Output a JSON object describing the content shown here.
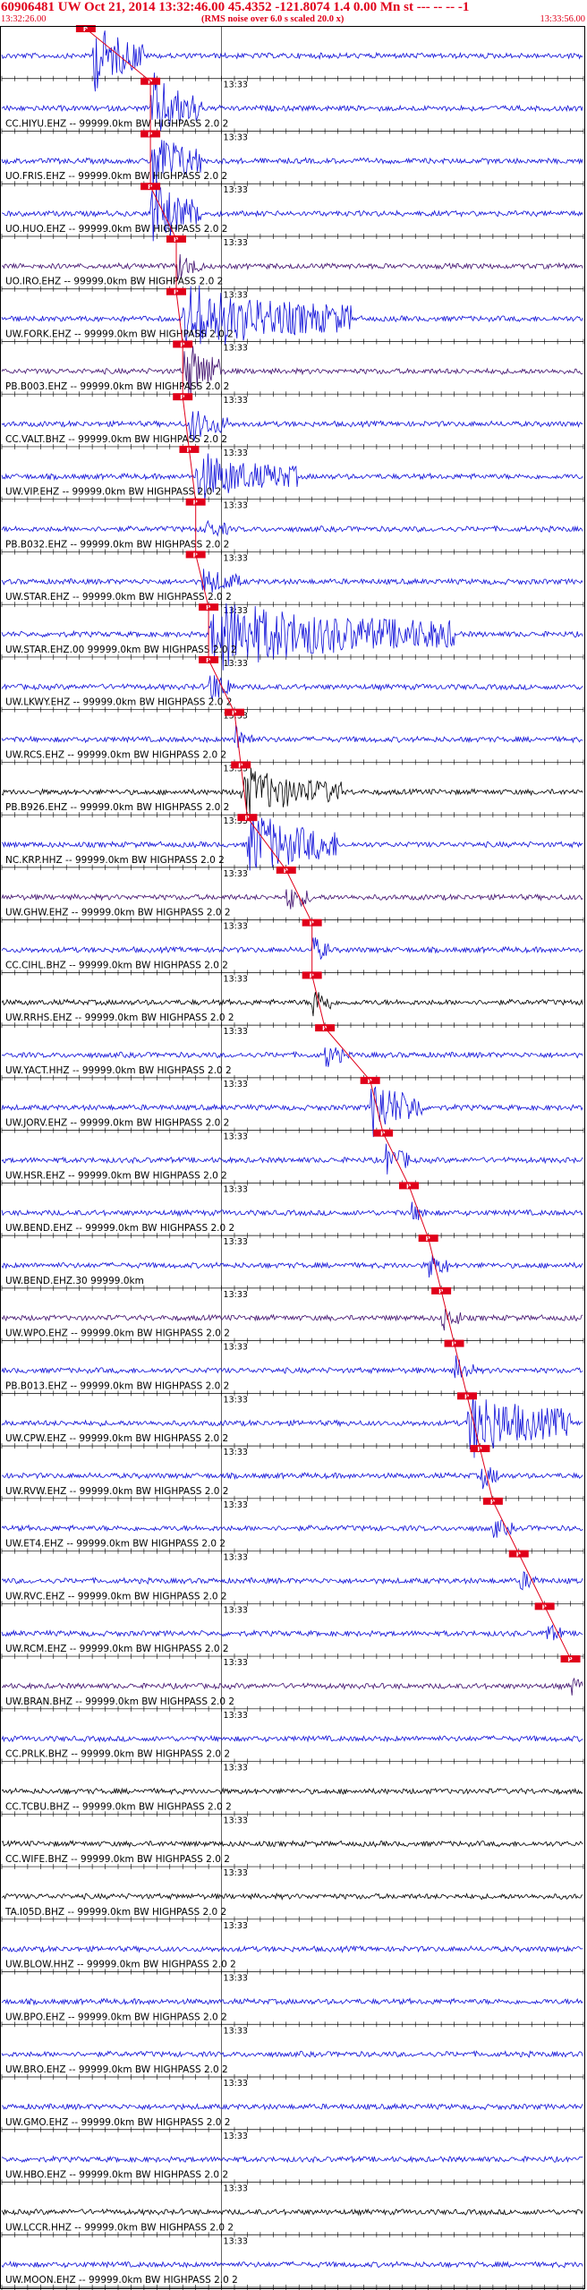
{
  "header": {
    "title": "60906481 UW Oct 21, 2014 13:32:46.00   45.4352 -121.8074  1.4 0.00 Mn st --- -- --  -1",
    "start_time": "13:32:26.00",
    "scale_note": "(RMS noise over 6.0 s scaled 20.0 x)",
    "end_time": "13:33:56.00"
  },
  "colors": {
    "trace_blue": "#1010d8",
    "trace_purple": "#40106e",
    "trace_black": "#000000",
    "pick_red": "#e0001a",
    "label_text": "#000000",
    "header_red": "#e0001a"
  },
  "chart_data": {
    "type": "seismogram-record-section",
    "time_window": {
      "start": "13:32:26.00",
      "end": "13:33:56.00",
      "minute_mark": "13:33"
    },
    "traces": [
      {
        "label": "",
        "color": "blue",
        "event_onset_s": 14,
        "duration_s": 8,
        "amplitude": 1.0,
        "pick_s": 13,
        "pick_label": "P"
      },
      {
        "label": "CC.HIYU.EHZ -- 99999.0km BW  HIGHPASS  2.0  2",
        "color": "blue",
        "event_onset_s": 23,
        "duration_s": 8,
        "amplitude": 1.0,
        "pick_s": 23,
        "pick_label": "P"
      },
      {
        "label": "UO.FRIS.EHZ -- 99999.0km BW  HIGHPASS  2.0  2",
        "color": "blue",
        "event_onset_s": 23,
        "duration_s": 8,
        "amplitude": 1.0,
        "pick_s": 23,
        "pick_label": "P"
      },
      {
        "label": "UO.HUO.EHZ -- 99999.0km BW  HIGHPASS  2.0  2",
        "color": "blue",
        "event_onset_s": 23,
        "duration_s": 8,
        "amplitude": 1.0,
        "pick_s": 23,
        "pick_label": "P"
      },
      {
        "label": "UO.IRO.EHZ -- 99999.0km BW  HIGHPASS  2.0  2",
        "color": "purple",
        "event_onset_s": 27,
        "duration_s": 4,
        "amplitude": 0.4,
        "pick_s": 27,
        "pick_label": "P"
      },
      {
        "label": "UW.FORK.EHZ -- 99999.0km BW  HIGHPASS  2.0  2",
        "color": "blue",
        "event_onset_s": 28,
        "duration_s": 26,
        "amplitude": 1.0,
        "pick_s": 27,
        "pick_label": "P"
      },
      {
        "label": "PB.B003.EHZ -- 99999.0km BW  HIGHPASS  2.0  2",
        "color": "purple",
        "event_onset_s": 28,
        "duration_s": 6,
        "amplitude": 1.0,
        "pick_s": 28,
        "pick_label": "P"
      },
      {
        "label": "CC.VALT.BHZ -- 99999.0km BW  HIGHPASS  2.0  2",
        "color": "blue",
        "event_onset_s": 29,
        "duration_s": 6,
        "amplitude": 0.5,
        "pick_s": 28,
        "pick_label": "P"
      },
      {
        "label": "UW.VIP.EHZ -- 99999.0km BW  HIGHPASS  2.0  2",
        "color": "blue",
        "event_onset_s": 30,
        "duration_s": 16,
        "amplitude": 0.7,
        "pick_s": 29,
        "pick_label": "P"
      },
      {
        "label": "PB.B032.EHZ -- 99999.0km BW  HIGHPASS  2.0  2",
        "color": "blue",
        "event_onset_s": 31,
        "duration_s": 4,
        "amplitude": 0.3,
        "pick_s": 30,
        "pick_label": "P"
      },
      {
        "label": "UW.STAR.EHZ -- 99999.0km BW  HIGHPASS  2.0  2",
        "color": "blue",
        "event_onset_s": 31,
        "duration_s": 6,
        "amplitude": 0.4,
        "pick_s": 30,
        "pick_label": "P"
      },
      {
        "label": "UW.STAR.EHZ.00 99999.0km BW  HIGHPASS  2.0  2",
        "color": "blue",
        "event_onset_s": 32,
        "duration_s": 38,
        "amplitude": 1.0,
        "pick_s": 32,
        "pick_label": "P"
      },
      {
        "label": "UW.LKWY.EHZ -- 99999.0km BW  HIGHPASS  2.0  2",
        "color": "blue",
        "event_onset_s": 32,
        "duration_s": 4,
        "amplitude": 0.5,
        "pick_s": 32,
        "pick_label": "P"
      },
      {
        "label": "UW.RCS.EHZ -- 99999.0km BW  HIGHPASS  2.0  2",
        "color": "blue",
        "event_onset_s": 36,
        "duration_s": 3,
        "amplitude": 0.4,
        "pick_s": 36,
        "pick_label": "P"
      },
      {
        "label": "PB.B926.EHZ -- 99999.0km BW  HIGHPASS  2.0  2",
        "color": "black",
        "event_onset_s": 37,
        "duration_s": 16,
        "amplitude": 0.7,
        "pick_s": 37,
        "pick_label": "P"
      },
      {
        "label": "NC.KRP.HHZ -- 99999.0km BW  HIGHPASS  2.0  2",
        "color": "blue",
        "event_onset_s": 38,
        "duration_s": 14,
        "amplitude": 1.0,
        "pick_s": 38,
        "pick_label": "P"
      },
      {
        "label": "UW.GHW.EHZ -- 99999.0km BW  HIGHPASS  2.0  2",
        "color": "purple",
        "event_onset_s": 44,
        "duration_s": 4,
        "amplitude": 0.4,
        "pick_s": 44,
        "pick_label": "P"
      },
      {
        "label": "CC.CIHL.BHZ -- 99999.0km BW  HIGHPASS  2.0  2",
        "color": "blue",
        "event_onset_s": 48,
        "duration_s": 3,
        "amplitude": 0.4,
        "pick_s": 48,
        "pick_label": "P"
      },
      {
        "label": "UW.RRHS.EHZ -- 99999.0km BW  HIGHPASS  2.0  2",
        "color": "black",
        "event_onset_s": 48,
        "duration_s": 3,
        "amplitude": 0.5,
        "pick_s": 48,
        "pick_label": "P"
      },
      {
        "label": "UW.YACT.HHZ -- 99999.0km BW  HIGHPASS  2.0  2",
        "color": "blue",
        "event_onset_s": 50,
        "duration_s": 3,
        "amplitude": 0.4,
        "pick_s": 50,
        "pick_label": "P"
      },
      {
        "label": "UW.JORV.EHZ -- 99999.0km BW  HIGHPASS  2.0  2",
        "color": "blue",
        "event_onset_s": 57,
        "duration_s": 8,
        "amplitude": 0.9,
        "pick_s": 57,
        "pick_label": "P"
      },
      {
        "label": "UW.HSR.EHZ -- 99999.0km BW  HIGHPASS  2.0  2",
        "color": "blue",
        "event_onset_s": 59,
        "duration_s": 4,
        "amplitude": 0.5,
        "pick_s": 59,
        "pick_label": "P"
      },
      {
        "label": "UW.BEND.EHZ -- 99999.0km BW  HIGHPASS  2.0  2",
        "color": "blue",
        "event_onset_s": 63,
        "duration_s": 3,
        "amplitude": 0.3,
        "pick_s": 63,
        "pick_label": "P"
      },
      {
        "label": "UW.BEND.EHZ.30 99999.0km",
        "color": "blue",
        "event_onset_s": 66,
        "duration_s": 3,
        "amplitude": 0.4,
        "pick_s": 66,
        "pick_label": "P"
      },
      {
        "label": "UW.WPO.EHZ -- 99999.0km BW  HIGHPASS  2.0  2",
        "color": "purple",
        "event_onset_s": 68,
        "duration_s": 3,
        "amplitude": 0.4,
        "pick_s": 68,
        "pick_label": "P"
      },
      {
        "label": "PB.B013.EHZ -- 99999.0km BW  HIGHPASS  2.0  2",
        "color": "blue",
        "event_onset_s": 70,
        "duration_s": 3,
        "amplitude": 0.4,
        "pick_s": 70,
        "pick_label": "P"
      },
      {
        "label": "UW.CPW.EHZ -- 99999.0km BW  HIGHPASS  2.0  2",
        "color": "blue",
        "event_onset_s": 72,
        "duration_s": 16,
        "amplitude": 1.0,
        "pick_s": 72,
        "pick_label": "P"
      },
      {
        "label": "UW.RVW.EHZ -- 99999.0km BW  HIGHPASS  2.0  2",
        "color": "blue",
        "event_onset_s": 74,
        "duration_s": 3,
        "amplitude": 0.4,
        "pick_s": 74,
        "pick_label": "P"
      },
      {
        "label": "UW.ET4.EHZ -- 99999.0km BW  HIGHPASS  2.0  2",
        "color": "blue",
        "event_onset_s": 76,
        "duration_s": 3,
        "amplitude": 0.3,
        "pick_s": 76,
        "pick_label": "P"
      },
      {
        "label": "UW.RVC.EHZ -- 99999.0km BW  HIGHPASS  2.0  2",
        "color": "blue",
        "event_onset_s": 80,
        "duration_s": 3,
        "amplitude": 0.3,
        "pick_s": 80,
        "pick_label": "P"
      },
      {
        "label": "UW.RCM.EHZ -- 99999.0km BW  HIGHPASS  2.0  2",
        "color": "blue",
        "event_onset_s": 84,
        "duration_s": 3,
        "amplitude": 0.3,
        "pick_s": 84,
        "pick_label": "P"
      },
      {
        "label": "UW.BRAN.BHZ -- 99999.0km BW  HIGHPASS  2.0  2",
        "color": "purple",
        "event_onset_s": 88,
        "duration_s": 2,
        "amplitude": 0.3,
        "pick_s": 88,
        "pick_label": "P"
      },
      {
        "label": "CC.PRLK.BHZ -- 99999.0km BW  HIGHPASS  2.0  2",
        "color": "blue",
        "event_onset_s": null,
        "duration_s": 0,
        "amplitude": 0,
        "pick_s": null,
        "pick_label": ""
      },
      {
        "label": "CC.TCBU.BHZ -- 99999.0km BW  HIGHPASS  2.0  2",
        "color": "black",
        "event_onset_s": null,
        "duration_s": 0,
        "amplitude": 0,
        "pick_s": null,
        "pick_label": ""
      },
      {
        "label": "CC.WIFE.BHZ -- 99999.0km BW  HIGHPASS  2.0  2",
        "color": "black",
        "event_onset_s": null,
        "duration_s": 0,
        "amplitude": 0,
        "pick_s": null,
        "pick_label": ""
      },
      {
        "label": "TA.I05D.BHZ -- 99999.0km BW  HIGHPASS  2.0  2",
        "color": "black",
        "event_onset_s": null,
        "duration_s": 0,
        "amplitude": 0,
        "pick_s": null,
        "pick_label": ""
      },
      {
        "label": "UW.BLOW.HHZ -- 99999.0km BW  HIGHPASS  2.0  2",
        "color": "blue",
        "event_onset_s": null,
        "duration_s": 0,
        "amplitude": 0,
        "pick_s": null,
        "pick_label": ""
      },
      {
        "label": "UW.BPO.EHZ -- 99999.0km BW  HIGHPASS  2.0  2",
        "color": "blue",
        "event_onset_s": null,
        "duration_s": 0,
        "amplitude": 0,
        "pick_s": null,
        "pick_label": ""
      },
      {
        "label": "UW.BRO.EHZ -- 99999.0km BW  HIGHPASS  2.0  2",
        "color": "blue",
        "event_onset_s": null,
        "duration_s": 0,
        "amplitude": 0,
        "pick_s": null,
        "pick_label": ""
      },
      {
        "label": "UW.GMO.EHZ -- 99999.0km BW  HIGHPASS  2.0  2",
        "color": "blue",
        "event_onset_s": null,
        "duration_s": 0,
        "amplitude": 0,
        "pick_s": null,
        "pick_label": ""
      },
      {
        "label": "UW.HBO.EHZ -- 99999.0km BW  HIGHPASS  2.0  2",
        "color": "blue",
        "event_onset_s": null,
        "duration_s": 0,
        "amplitude": 0,
        "pick_s": null,
        "pick_label": ""
      },
      {
        "label": "UW.LCCR.HHZ -- 99999.0km BW  HIGHPASS  2.0  2",
        "color": "black",
        "event_onset_s": null,
        "duration_s": 0,
        "amplitude": 0,
        "pick_s": null,
        "pick_label": ""
      },
      {
        "label": "UW.MOON.EHZ -- 99999.0km BW  HIGHPASS  2.0  2",
        "color": "blue",
        "event_onset_s": null,
        "duration_s": 0,
        "amplitude": 0,
        "pick_s": null,
        "pick_label": ""
      }
    ]
  }
}
